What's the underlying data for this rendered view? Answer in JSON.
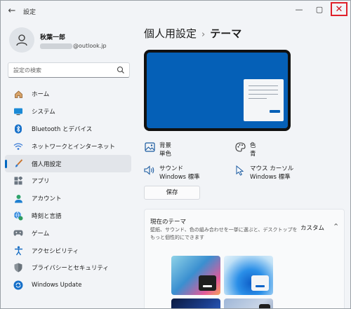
{
  "window": {
    "title": "設定"
  },
  "user": {
    "name": "秋葉一郎",
    "email_suffix": "@outlook.jp"
  },
  "search": {
    "placeholder": "設定の検索"
  },
  "nav": [
    {
      "label": "ホーム",
      "icon": "home-icon"
    },
    {
      "label": "システム",
      "icon": "system-icon"
    },
    {
      "label": "Bluetooth とデバイス",
      "icon": "bluetooth-icon"
    },
    {
      "label": "ネットワークとインターネット",
      "icon": "wifi-icon"
    },
    {
      "label": "個人用設定",
      "icon": "brush-icon",
      "selected": true
    },
    {
      "label": "アプリ",
      "icon": "apps-icon"
    },
    {
      "label": "アカウント",
      "icon": "account-icon"
    },
    {
      "label": "時刻と言語",
      "icon": "globe-clock-icon"
    },
    {
      "label": "ゲーム",
      "icon": "gamepad-icon"
    },
    {
      "label": "アクセシビリティ",
      "icon": "accessibility-icon"
    },
    {
      "label": "プライバシーとセキュリティ",
      "icon": "shield-icon"
    },
    {
      "label": "Windows Update",
      "icon": "update-icon"
    }
  ],
  "breadcrumb": {
    "parent": "個人用設定",
    "separator": "›",
    "current": "テーマ"
  },
  "quick_settings": {
    "background": {
      "title": "背景",
      "value": "単色"
    },
    "color": {
      "title": "色",
      "value": "青"
    },
    "sound": {
      "title": "サウンド",
      "value": "Windows 標準"
    },
    "cursor": {
      "title": "マウス カーソル",
      "value": "Windows 標準"
    }
  },
  "save_label": "保存",
  "current_theme": {
    "title": "現在のテーマ",
    "description": "壁紙、サウンド、色の組み合わせを一挙に選ぶと、デスクトップをもっと個性的にできます",
    "value": "カスタム"
  },
  "colors": {
    "accent": "#0067c0",
    "preview_blue": "#0560b7",
    "close_highlight": "#e0202a"
  }
}
